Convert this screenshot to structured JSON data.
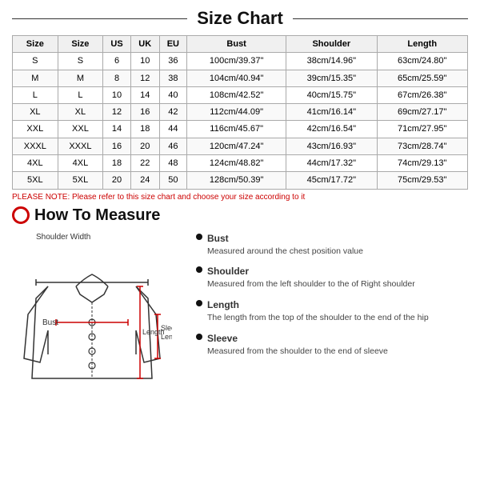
{
  "title": "Size Chart",
  "table": {
    "headers": [
      "Size",
      "Size",
      "US",
      "UK",
      "EU",
      "Bust",
      "Shoulder",
      "Length"
    ],
    "rows": [
      [
        "S",
        "S",
        "6",
        "10",
        "36",
        "100cm/39.37\"",
        "38cm/14.96\"",
        "63cm/24.80\""
      ],
      [
        "M",
        "M",
        "8",
        "12",
        "38",
        "104cm/40.94\"",
        "39cm/15.35\"",
        "65cm/25.59\""
      ],
      [
        "L",
        "L",
        "10",
        "14",
        "40",
        "108cm/42.52\"",
        "40cm/15.75\"",
        "67cm/26.38\""
      ],
      [
        "XL",
        "XL",
        "12",
        "16",
        "42",
        "112cm/44.09\"",
        "41cm/16.14\"",
        "69cm/27.17\""
      ],
      [
        "XXL",
        "XXL",
        "14",
        "18",
        "44",
        "116cm/45.67\"",
        "42cm/16.54\"",
        "71cm/27.95\""
      ],
      [
        "XXXL",
        "XXXL",
        "16",
        "20",
        "46",
        "120cm/47.24\"",
        "43cm/16.93\"",
        "73cm/28.74\""
      ],
      [
        "4XL",
        "4XL",
        "18",
        "22",
        "48",
        "124cm/48.82\"",
        "44cm/17.32\"",
        "74cm/29.13\""
      ],
      [
        "5XL",
        "5XL",
        "20",
        "24",
        "50",
        "128cm/50.39\"",
        "45cm/17.72\"",
        "75cm/29.53\""
      ]
    ]
  },
  "note": "PLEASE NOTE: Please refer to this size chart and choose your size according to it",
  "how_to_measure": {
    "title": "How To Measure",
    "labels": {
      "shoulder_width": "Shoulder Width",
      "bust": "Bust",
      "sleeve_length": "Sleeve\nLength",
      "length": "Length"
    },
    "bullets": [
      {
        "title": "Bust",
        "desc": "Measured around the chest position value"
      },
      {
        "title": "Shoulder",
        "desc": "Measured from the left shoulder to the of Right shoulder"
      },
      {
        "title": "Length",
        "desc": "The length from the top of the shoulder to the end of the hip"
      },
      {
        "title": "Sleeve",
        "desc": "Measured from the shoulder to the end of sleeve"
      }
    ]
  }
}
